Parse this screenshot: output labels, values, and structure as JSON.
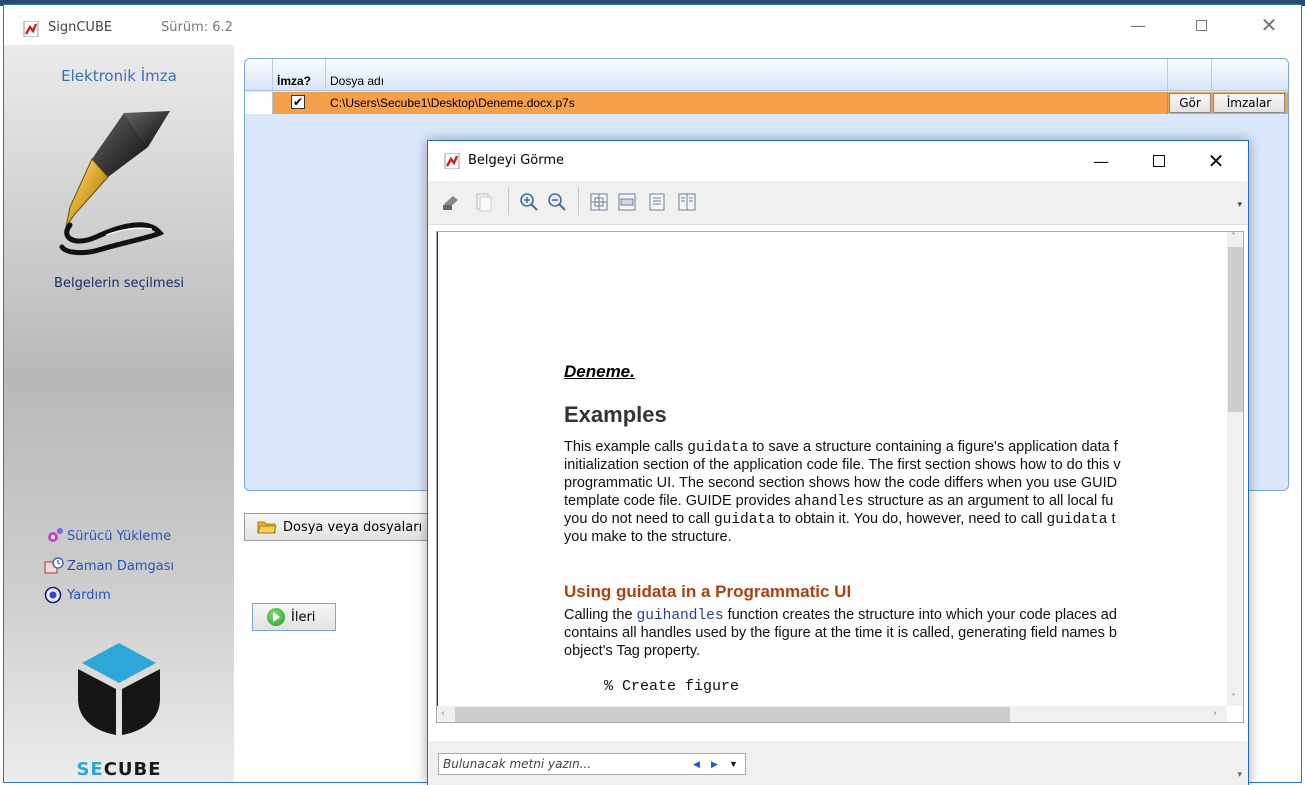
{
  "window": {
    "app_title": "SignCUBE",
    "version": "Sürüm: 6.2",
    "min_symbol": "—",
    "close_symbol": "✕"
  },
  "sidebar": {
    "title": "Elektronik İmza",
    "section": "Belgelerin seçilmesi",
    "links": [
      {
        "label": "Sürücü Yükleme",
        "icon": "gear-icon"
      },
      {
        "label": "Zaman Damgası",
        "icon": "clock-icon"
      },
      {
        "label": "Yardım",
        "icon": "help-icon"
      }
    ],
    "brand": "SECUBE",
    "brand_accent": "SE"
  },
  "grid": {
    "columns": [
      "İmza?",
      "Dosya adı"
    ],
    "rows": [
      {
        "checked": true,
        "check_symbol": "✔",
        "file": "C:\\Users\\Secube1\\Desktop\\Deneme.docx.p7s",
        "view_label": "Gör",
        "signatures_label": "İmzalar"
      }
    ]
  },
  "buttons": {
    "select_files": "Dosya veya dosyaları",
    "next": "İleri"
  },
  "dialog": {
    "title": "Belgeyi Görme",
    "min_symbol": "—",
    "close_symbol": "✕",
    "toolbar": [
      "print-icon",
      "copy-icon",
      "zoom-in-icon",
      "zoom-out-icon",
      "fit-page-icon",
      "fit-width-icon",
      "single-page-icon",
      "two-page-icon"
    ],
    "document": {
      "title": "Deneme.",
      "heading": "Examples",
      "para1": [
        {
          "t": "This example calls ",
          "mono": "guidata",
          "t2": " to save a structure containing a figure's application data f"
        },
        {
          "t": "initialization section of the application code file. The first section shows how to do this v",
          "mono": "",
          "t2": ""
        },
        {
          "t": "programmatic UI. The second section shows how the code differs when you use GUID",
          "mono": "",
          "t2": ""
        },
        {
          "t": "template code file. GUIDE provides a",
          "mono": "handles",
          "t2": " structure as an argument to all local fu"
        },
        {
          "t": "you do not need to call ",
          "mono": "guidata",
          "t2": " to obtain it. You do, however, need to call "
        },
        {
          "t": "you make to the structure.",
          "mono": "",
          "t2": ""
        }
      ],
      "para1_line5_tail_mono": "guidata",
      "para1_line5_tail_end": " t",
      "heading2": "Using guidata in a Programmatic UI",
      "para2": [
        {
          "t": "Calling the ",
          "mono": "guihandles",
          "t2": " function creates the structure into which your code places ad"
        },
        {
          "t": "contains all handles used by the figure at the time it is called, generating field names b",
          "mono": "",
          "t2": ""
        },
        {
          "t": "object's Tag property.",
          "mono": "",
          "t2": ""
        }
      ],
      "code": "% Create figure"
    },
    "find": {
      "placeholder": "Bulunacak metni yazın..."
    }
  }
}
